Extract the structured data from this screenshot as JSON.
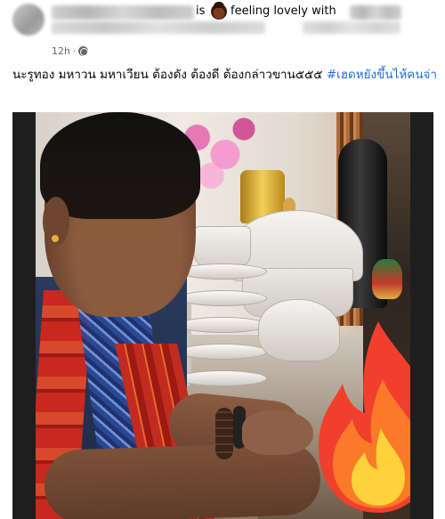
{
  "post": {
    "connector_text": "is",
    "feeling": {
      "icon": "smiling-face-with-cowboy-hat-emoji-icon",
      "text": "feeling lovely with"
    },
    "timestamp": "12h",
    "separator": "·",
    "audience_icon": "globe-icon"
  },
  "caption": {
    "text": "นะรูทอง มหาวน มหาเวียน ต้องดัง ต้องดี ต้องกล่าวขาน๕๕๕ ",
    "hashtag": "#เฮดหยังขึ้นไห้คนจ่า"
  },
  "photo": {
    "overlay_icon": "fire-emoji-icon",
    "colors": {
      "fire_outer": "#f13f2e",
      "fire_mid": "#fa7a29",
      "fire_inner": "#ffd13b"
    }
  },
  "colors": {
    "hashtag": "#216fdb",
    "meta_text": "#65676b"
  }
}
